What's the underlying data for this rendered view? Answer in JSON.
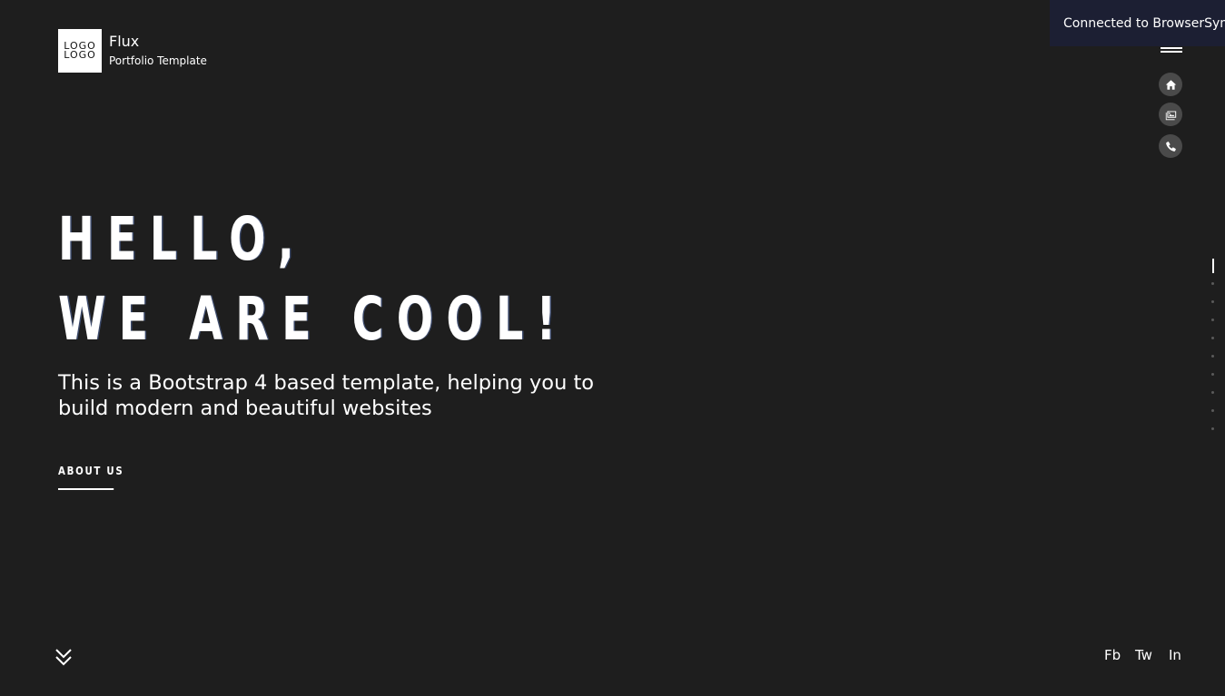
{
  "brand": {
    "logo_line1": "LOGO",
    "logo_line2": "LOGO",
    "name": "Flux",
    "subtitle": "Portfolio Template"
  },
  "toast": {
    "text": "Connected to BrowserSync"
  },
  "nav": {
    "icons": [
      "home-icon",
      "gallery-icon",
      "phone-icon"
    ]
  },
  "hero": {
    "line1": "HELLO,",
    "line2": "WE ARE COOL!",
    "subtitle": "This is a Bootstrap 4 based template, helping you to build modern and beautiful websites",
    "cta_label": "ABOUT US"
  },
  "social": {
    "fb": "Fb",
    "tw": "Tw",
    "in": "In"
  },
  "pager": {
    "active_index": 0,
    "dot_count": 9
  },
  "colors": {
    "background": "#1e1e1e",
    "text": "#ffffff",
    "toast_bg": "#1c1f33",
    "icon_circle": "#4a4a4a"
  }
}
